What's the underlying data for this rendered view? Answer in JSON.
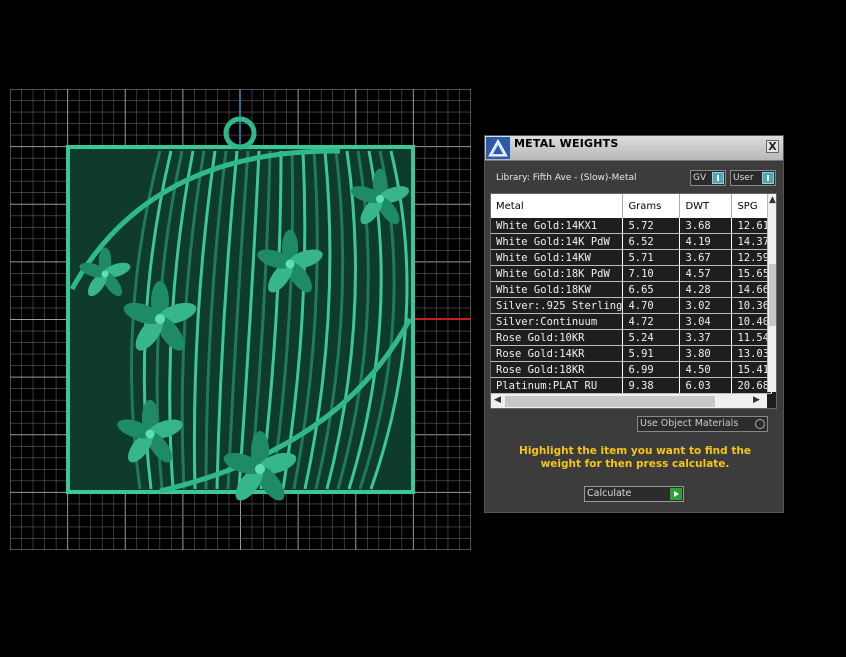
{
  "panel": {
    "title": "METAL WEIGHTS",
    "close_label": "X",
    "library_label": "Library: Fifth Ave - (Slow)-Metal",
    "toggles": [
      {
        "label": "GV",
        "state": "on"
      },
      {
        "label": "User",
        "state": "on"
      }
    ],
    "table": {
      "columns": [
        "Metal",
        "Grams",
        "DWT",
        "SPG"
      ],
      "rows": [
        {
          "metal": "White Gold:14KX1",
          "grams": "5.72",
          "dwt": "3.68",
          "spg": "12.61"
        },
        {
          "metal": "White Gold:14K PdW",
          "grams": "6.52",
          "dwt": "4.19",
          "spg": "14.37"
        },
        {
          "metal": "White Gold:14KW",
          "grams": "5.71",
          "dwt": "3.67",
          "spg": "12.59"
        },
        {
          "metal": "White Gold:18K PdW",
          "grams": "7.10",
          "dwt": "4.57",
          "spg": "15.65"
        },
        {
          "metal": "White Gold:18KW",
          "grams": "6.65",
          "dwt": "4.28",
          "spg": "14.66"
        },
        {
          "metal": "Silver:.925 Sterling",
          "grams": "4.70",
          "dwt": "3.02",
          "spg": "10.36"
        },
        {
          "metal": "Silver:Continuum",
          "grams": "4.72",
          "dwt": "3.04",
          "spg": "10.40"
        },
        {
          "metal": "Rose Gold:10KR",
          "grams": "5.24",
          "dwt": "3.37",
          "spg": "11.54"
        },
        {
          "metal": "Rose Gold:14KR",
          "grams": "5.91",
          "dwt": "3.80",
          "spg": "13.03"
        },
        {
          "metal": "Rose Gold:18KR",
          "grams": "6.99",
          "dwt": "4.50",
          "spg": "15.41"
        },
        {
          "metal": "Platinum:PLAT RU",
          "grams": "9.38",
          "dwt": "6.03",
          "spg": "20.68"
        }
      ]
    },
    "use_object_materials_label": "Use Object Materials",
    "instruction": "Highlight the item you want to find the weight for then press calculate.",
    "calculate_label": "Calculate"
  },
  "colors": {
    "background": "#000000",
    "grid": "#7a7a7a",
    "model": "#2a8f6e",
    "highlight_text": "#f5c518",
    "axis_x": "#c02020",
    "axis_y": "#1e6fa0"
  },
  "icons": {
    "app_logo": "triangle-logo-icon",
    "close": "close-icon",
    "calculate": "play-icon"
  }
}
